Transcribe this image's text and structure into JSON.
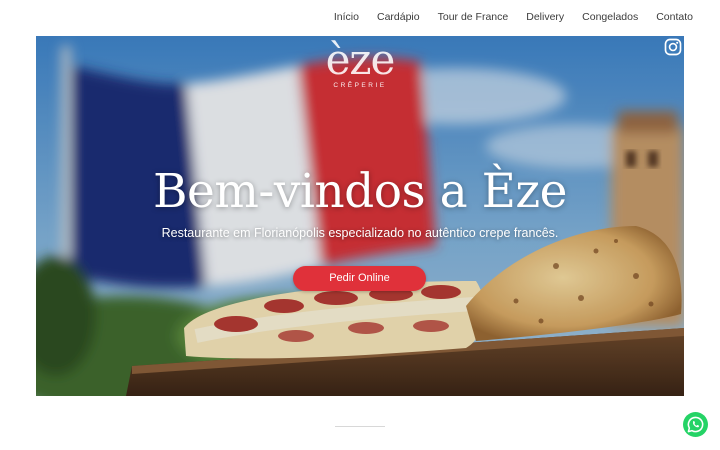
{
  "nav": {
    "items": [
      "Início",
      "Cardápio",
      "Tour de France",
      "Delivery",
      "Congelados",
      "Contato"
    ]
  },
  "logo": {
    "word": "èze",
    "subtitle": "CRÊPERIE"
  },
  "hero": {
    "headline": "Bem-vindos a Èze",
    "subheadline": "Restaurante em Florianópolis especializado no autêntico crepe francês.",
    "cta_label": "Pedir Online"
  },
  "icons": {
    "social": "instagram-icon",
    "chat": "whatsapp-icon"
  },
  "colors": {
    "accent": "#e0313a",
    "whatsapp": "#25d366",
    "nav_text": "#3c3c3c"
  }
}
